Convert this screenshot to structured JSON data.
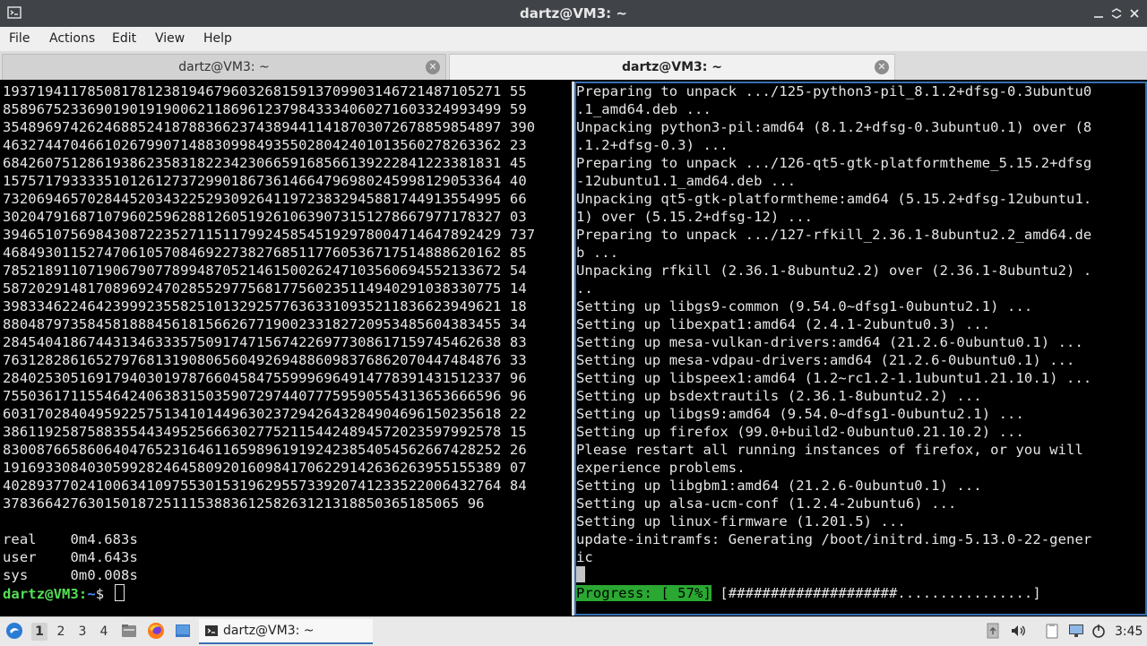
{
  "window": {
    "title": "dartz@VM3: ~"
  },
  "menu": {
    "file": "File",
    "actions": "Actions",
    "edit": "Edit",
    "view": "View",
    "help": "Help"
  },
  "tabs": [
    {
      "label": "dartz@VM3: ~",
      "active": false
    },
    {
      "label": "dartz@VM3: ~",
      "active": true
    }
  ],
  "left_terminal": {
    "lines": [
      "19371941178508178123819467960326815913709903146721487105271 55",
      "85896752336901901919006211869612379843334060271603324993499 59",
      "35489697426246885241878836623743894411418703072678859854897 390",
      "46327447046610267990714883099849355028042401013560278263362 23",
      "68426075128619386235831822342306659168566139222841223381831 45",
      "15757179333351012612737299018673614664796980245998129053364 40",
      "73206946570284452034322529309264119723832945881744913554995 66",
      "30204791687107960259628812605192610639073151278667977178327 03",
      "39465107569843087223527115117992458545192978004714647892429 737",
      "46849301152747061057084692273827685117760536717514888620162 85",
      "78521891107190679077899487052146150026247103560694552133672 54",
      "58720291481708969247028552977568177560235114940291038330775 14",
      "39833462246423999235582510132925776363310935211836623949621 18",
      "88048797358458188845618156626771900233182720953485604383455 34",
      "28454041867443134633357509174715674226977308617159745462638 83",
      "76312828616527976813190806560492694886098376862070447484876 33",
      "28402530516917940301978766045847559996964914778391431512337 96",
      "75503617115546424063831503590729744077759590554313653666596 96",
      "60317028404959225751341014496302372942643284904696150235618 22",
      "38611925875883554434952566630277521154424894572023597992578 15",
      "83008766586064047652316461165989619192423854054562667428252 26",
      "19169330840305992824645809201609841706229142636263955155389 07",
      "40289377024100634109755301531962955733920741233522006432764 84",
      "378366427630150187251115388361258263121318850365185065 96",
      "",
      "real\t0m4.683s",
      "user\t0m4.643s",
      "sys\t0m0.008s"
    ],
    "prompt_user": "dartz@VM3:",
    "prompt_path": "~",
    "prompt_symbol": "$"
  },
  "right_terminal": {
    "lines": [
      "Preparing to unpack .../125-python3-pil_8.1.2+dfsg-0.3ubuntu0",
      ".1_amd64.deb ...",
      "Unpacking python3-pil:amd64 (8.1.2+dfsg-0.3ubuntu0.1) over (8",
      ".1.2+dfsg-0.3) ...",
      "Preparing to unpack .../126-qt5-gtk-platformtheme_5.15.2+dfsg",
      "-12ubuntu1.1_amd64.deb ...",
      "Unpacking qt5-gtk-platformtheme:amd64 (5.15.2+dfsg-12ubuntu1.",
      "1) over (5.15.2+dfsg-12) ...",
      "Preparing to unpack .../127-rfkill_2.36.1-8ubuntu2.2_amd64.de",
      "b ...",
      "Unpacking rfkill (2.36.1-8ubuntu2.2) over (2.36.1-8ubuntu2) .",
      "..",
      "Setting up libgs9-common (9.54.0~dfsg1-0ubuntu2.1) ...",
      "Setting up libexpat1:amd64 (2.4.1-2ubuntu0.3) ...",
      "Setting up mesa-vulkan-drivers:amd64 (21.2.6-0ubuntu0.1) ...",
      "Setting up mesa-vdpau-drivers:amd64 (21.2.6-0ubuntu0.1) ...",
      "Setting up libspeex1:amd64 (1.2~rc1.2-1.1ubuntu1.21.10.1) ...",
      "Setting up bsdextrautils (2.36.1-8ubuntu2.2) ...",
      "Setting up libgs9:amd64 (9.54.0~dfsg1-0ubuntu2.1) ...",
      "Setting up firefox (99.0+build2-0ubuntu0.21.10.2) ...",
      "Please restart all running instances of firefox, or you will",
      "experience problems.",
      "Setting up libgbm1:amd64 (21.2.6-0ubuntu0.1) ...",
      "Setting up alsa-ucm-conf (1.2.4-2ubuntu6) ...",
      "Setting up linux-firmware (1.201.5) ...",
      "update-initramfs: Generating /boot/initrd.img-5.13.0-22-gener",
      "ic"
    ],
    "progress_label": "Progress: [ 57%]",
    "progress_bar": "[####################................]",
    "progress_fraction": 0.57
  },
  "taskbar": {
    "workspaces": [
      "1",
      "2",
      "3",
      "4"
    ],
    "active_workspace": "1",
    "task_label": "dartz@VM3: ~",
    "clock": "3:45"
  },
  "colors": {
    "titlebar": "#404448",
    "prompt_green": "#55e055",
    "prompt_blue": "#4c8cff",
    "progress_green": "#2aa832",
    "focus_border": "#3a6fb1"
  },
  "icons": {
    "menu": "lxqt-menu-icon",
    "files": "file-manager-icon",
    "browser": "firefox-icon",
    "desktop": "show-desktop-icon",
    "terminal": "terminal-icon",
    "updates": "update-notifier-icon",
    "volume": "volume-icon",
    "clipboard": "clipboard-icon",
    "network": "network-icon",
    "power": "power-icon"
  }
}
